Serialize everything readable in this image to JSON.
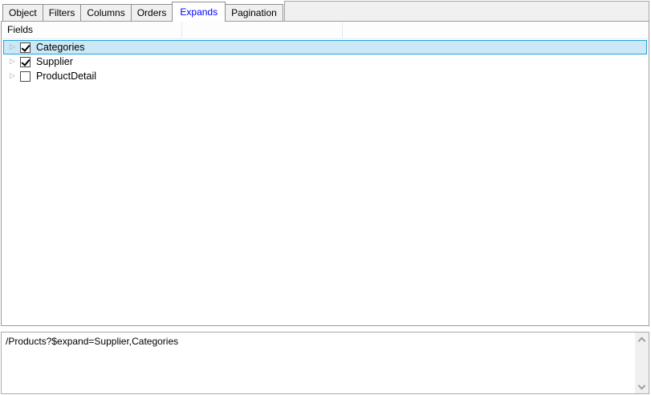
{
  "tabs": [
    {
      "label": "Object",
      "active": false
    },
    {
      "label": "Filters",
      "active": false
    },
    {
      "label": "Columns",
      "active": false
    },
    {
      "label": "Orders",
      "active": false
    },
    {
      "label": "Expands",
      "active": true
    },
    {
      "label": "Pagination",
      "active": false
    }
  ],
  "fields_panel": {
    "header": "Fields",
    "items": [
      {
        "label": "Categories",
        "checked": true,
        "selected": true,
        "expandable": true
      },
      {
        "label": "Supplier",
        "checked": true,
        "selected": false,
        "expandable": true
      },
      {
        "label": "ProductDetail",
        "checked": false,
        "selected": false,
        "expandable": true
      }
    ]
  },
  "query_preview": {
    "text": "/Products?$expand=Supplier,Categories"
  },
  "colors": {
    "active_tab_text": "#0000ff",
    "selection_fill": "#cbe8f6",
    "selection_border": "#26a0da",
    "tab_inactive_bg": "#f0f0f0"
  }
}
